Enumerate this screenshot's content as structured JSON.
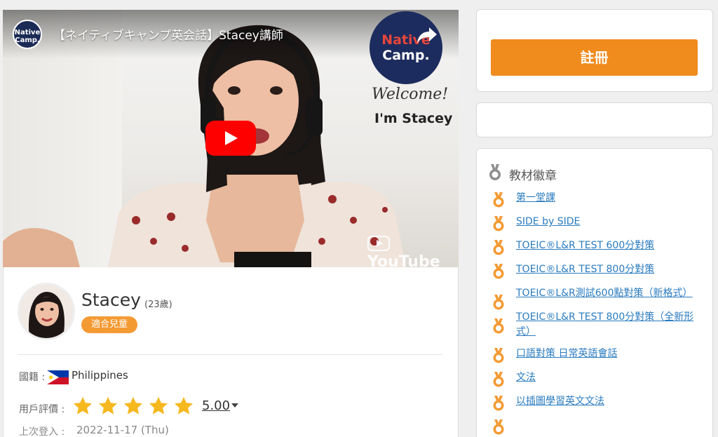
{
  "video": {
    "channel_logo": {
      "top": "ネイティブキャンプ",
      "line1": "Native",
      "line2": "Camp."
    },
    "title": "【ネイティブキャンプ英会話】Stacey講師",
    "brand": {
      "line1": "Native",
      "line2": "Camp."
    },
    "share_label": "",
    "welcome_text": "Welcome!",
    "intro_text": "I'm Stacey",
    "youtube_label": "YouTube",
    "icons": {
      "play": "play-icon",
      "share": "share-icon",
      "youtube": "youtube-icon"
    }
  },
  "profile": {
    "name": "Stacey",
    "age": "(23歲)",
    "badge": "適合兒童",
    "nationality_label": "國籍 :",
    "nationality": "Philippines",
    "rating_label": "用戶評價 :",
    "rating_value": "5.00",
    "rating_stars": 5,
    "last_login_label": "上次登入 :",
    "last_login": "2022-11-17 (Thu)"
  },
  "sidebar": {
    "register_label": "註冊",
    "badges_title": "教材徽章",
    "badges": [
      {
        "label": "第一堂課",
        "lines": 1
      },
      {
        "label": "SIDE by SIDE",
        "lines": 1
      },
      {
        "label": "TOEIC®L&R TEST 600分對策",
        "lines": 1
      },
      {
        "label": "TOEIC®L&R TEST 800分對策",
        "lines": 1
      },
      {
        "label": "TOEIC®L&R測試600點對策（新格式）",
        "lines": 2
      },
      {
        "label": "TOEIC®L&R TEST 800分對策（全新形式）",
        "lines": 2
      },
      {
        "label": "口語對策 日常英語會話",
        "lines": 1
      },
      {
        "label": "文法",
        "lines": 1
      },
      {
        "label": "以插圖學習英文文法",
        "lines": 1
      },
      {
        "label": "",
        "lines": 1
      }
    ]
  },
  "colors": {
    "accent_orange": "#f08b1d",
    "badge_orange": "#f49a33",
    "star_yellow": "#f6b81f",
    "link_blue": "#2a7bbf",
    "youtube_red": "#ff0000"
  }
}
